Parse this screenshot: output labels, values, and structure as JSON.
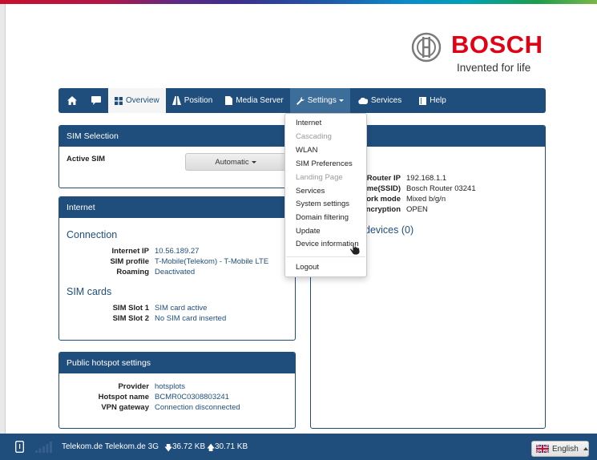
{
  "brand": {
    "name": "BOSCH",
    "slogan": "Invented for life"
  },
  "navbar": {
    "overview": "Overview",
    "position": "Position",
    "media_server": "Media Server",
    "settings": "Settings",
    "services": "Services",
    "help": "Help"
  },
  "settings_menu": {
    "items": [
      "Internet",
      "Cascading",
      "WLAN",
      "SIM Preferences",
      "Landing Page",
      "Services",
      "System settings",
      "Domain filtering",
      "Update",
      "Device information",
      "Logout"
    ],
    "disabled": [
      "Cascading",
      "Landing Page"
    ]
  },
  "sim_selection": {
    "title": "SIM Selection",
    "active_sim_label": "Active SIM",
    "active_sim_value": "Automatic"
  },
  "internet": {
    "title": "Internet",
    "connection_heading": "Connection",
    "ip_label": "Internet IP",
    "ip_value": "10.56.189.27",
    "profile_label": "SIM profile",
    "profile_value": "T-Mobile(Telekom) - T-Mobile LTE",
    "roaming_label": "Roaming",
    "roaming_value": "Deactivated",
    "simcards_heading": "SIM cards",
    "slot1_label": "SIM Slot 1",
    "slot1_value": "SIM card active",
    "slot2_label": "SIM Slot 2",
    "slot2_value": "No SIM card inserted"
  },
  "hotspot": {
    "title": "Public hotspot settings",
    "provider_label": "Provider",
    "provider_value": "hotsplots",
    "name_label": "Hotspot name",
    "name_value": "BCMR0C0308803241",
    "vpn_label": "VPN gateway",
    "vpn_value": "Connection disconnected"
  },
  "router": {
    "ip_label": "Router IP",
    "ip_value": "192.168.1.1",
    "ssid_label": "ame(SSID)",
    "ssid_value": "Bosch Router 03241",
    "mode_label": "rork mode",
    "mode_value": "Mixed b/g/n",
    "enc_label": "ncryption",
    "enc_value": "OPEN",
    "devices_heading": "devices (0)"
  },
  "statusbar": {
    "network": "Telekom.de Telekom.de 3G",
    "download": "36.72 KB",
    "upload": "30.71 KB",
    "language": "English"
  },
  "colors": {
    "brand_red": "#e20015",
    "nav_blue": "#1f4e7c"
  }
}
